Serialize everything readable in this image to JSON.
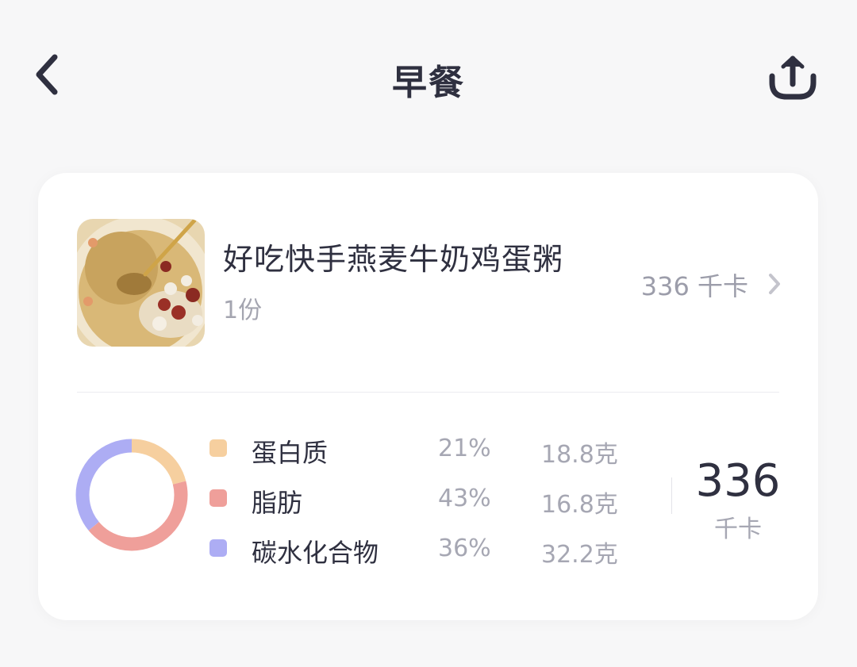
{
  "header": {
    "title": "早餐",
    "back_icon": "chevron-left-icon",
    "share_icon": "share-upload-icon"
  },
  "food": {
    "name": "好吃快手燕麦牛奶鸡蛋粥",
    "portion": "1份",
    "calories": "336 千卡",
    "chevron_icon": "chevron-right-icon"
  },
  "nutrition": {
    "items": [
      {
        "name": "蛋白质",
        "percent": "21%",
        "grams": "18.8克",
        "color": "#f6cf9f"
      },
      {
        "name": "脂肪",
        "percent": "43%",
        "grams": "16.8克",
        "color": "#ef9f9a"
      },
      {
        "name": "碳水化合物",
        "percent": "36%",
        "grams": "32.2克",
        "color": "#adadf4"
      }
    ],
    "total_value": "336",
    "total_unit": "千卡"
  },
  "colors": {
    "text_primary": "#2f3040",
    "text_secondary": "#a6a7b3",
    "background": "#f7f7f8",
    "card": "#ffffff"
  }
}
